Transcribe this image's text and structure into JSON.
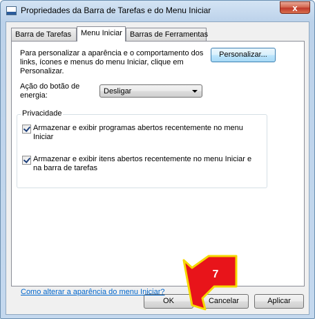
{
  "window": {
    "title": "Propriedades da Barra de Tarefas e do Menu Iniciar",
    "close_symbol": "x"
  },
  "tabs": [
    {
      "label": "Barra de Tarefas",
      "active": false
    },
    {
      "label": "Menu Iniciar",
      "active": true
    },
    {
      "label": "Barras de Ferramentas",
      "active": false
    }
  ],
  "panel": {
    "description": "Para personalizar a aparência e o comportamento dos links, ícones e menus do menu Iniciar, clique em Personalizar.",
    "customize_button": "Personalizar...",
    "power_action_label": "Ação do botão de energia:",
    "power_action_value": "Desligar",
    "privacy": {
      "title": "Privacidade",
      "items": [
        {
          "label": "Armazenar e exibir programas abertos recentemente no menu Iniciar",
          "checked": true
        },
        {
          "label": "Armazenar e exibir itens abertos recentemente no menu Iniciar e na barra de tarefas",
          "checked": true
        }
      ]
    },
    "help_link": "Como alterar a aparência do menu Iniciar?"
  },
  "footer": {
    "ok": "OK",
    "cancel": "Cancelar",
    "apply": "Aplicar"
  },
  "annotation": {
    "number": "7",
    "color": "#e8141a",
    "outline_color": "#f5d800"
  },
  "colors": {
    "window_frame": "#bcd2ea",
    "close_button": "#c0392b",
    "link": "#0066cc",
    "check_mark": "#1c3e7a"
  }
}
